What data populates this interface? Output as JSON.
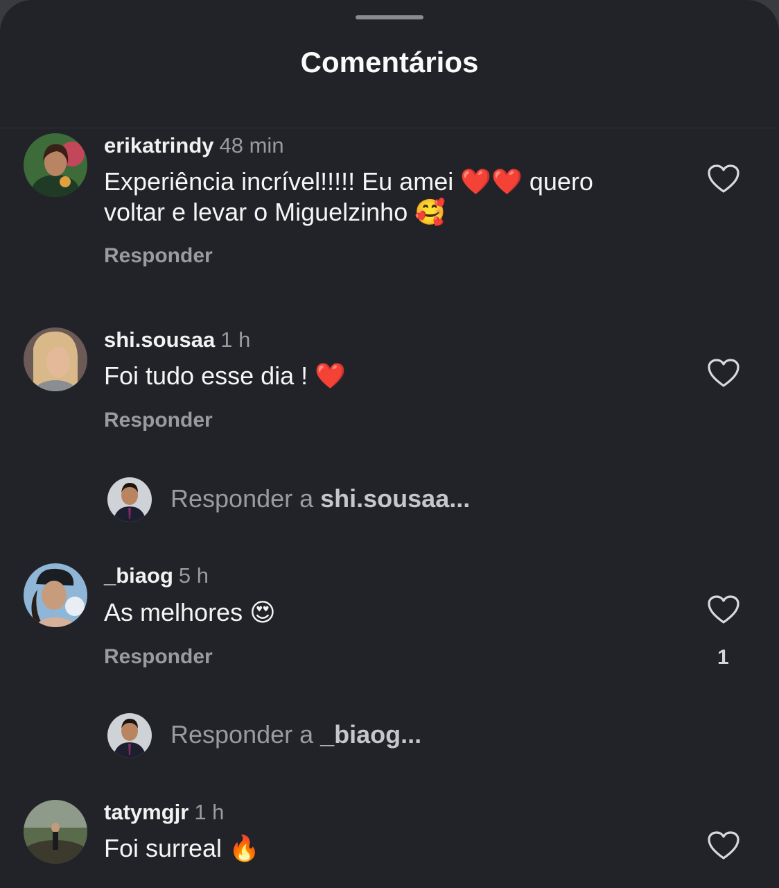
{
  "header": {
    "title": "Comentários"
  },
  "comments": [
    {
      "username": "erikatrindy",
      "time": "48 min",
      "text_a": "Experiência incrível!!!!! Eu amei ",
      "text_b": " quero voltar e levar o Miguelzinho ",
      "reply_label": "Responder",
      "emoji_hearts": "❤️❤️",
      "emoji_end": "🥰"
    },
    {
      "username": "shi.sousaa",
      "time": "1 h",
      "text": "Foi tudo esse dia ! ",
      "emoji_end": "❤️",
      "reply_label": "Responder"
    },
    {
      "username": "_biaog",
      "time": "5 h",
      "text": "As melhores ",
      "emoji_end": "😍",
      "reply_label": "Responder",
      "like_count": "1"
    },
    {
      "username": "tatymgjr",
      "time": "1 h",
      "text": "Foi surreal ",
      "emoji_end": "🔥"
    }
  ],
  "reply_prompts": [
    {
      "prefix": "Responder a ",
      "target": "shi.sousaa..."
    },
    {
      "prefix": "Responder a ",
      "target": "_biaog..."
    }
  ],
  "icons": {
    "like": "heart-outline-icon"
  }
}
